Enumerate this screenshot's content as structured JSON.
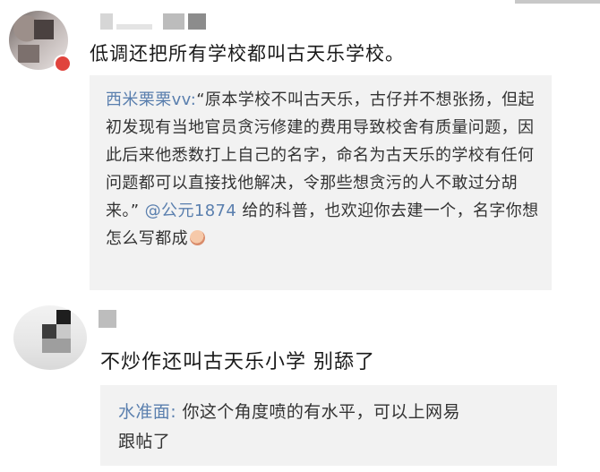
{
  "comment1": {
    "text": "低调还把所有学校都叫古天乐学校。",
    "quote": {
      "author": "西米栗栗vv:",
      "body_part1": "“原本学校不叫古天乐，古仔并不想张扬，但起初发现有当地官员贪污修建的费用导致校舍有质量问题，因此后来他悉数打上自己的名字，命名为古天乐的学校有任何问题都可以直接找他解决，令那些想贪污的人不敢过分胡来。”",
      "mention": "@公元1874",
      "body_part2": " 给的科普，也欢迎你去建一个，名字你想怎么写都成"
    }
  },
  "comment2": {
    "text": "不炒作还叫古天乐小学 别舔了",
    "quote": {
      "author": "水准面:",
      "body": " 你这个角度喷的有水平，可以上网易跟帖了"
    }
  },
  "icons": {
    "emoji": "blush-emoji-icon",
    "badge": "verified-badge-icon"
  }
}
